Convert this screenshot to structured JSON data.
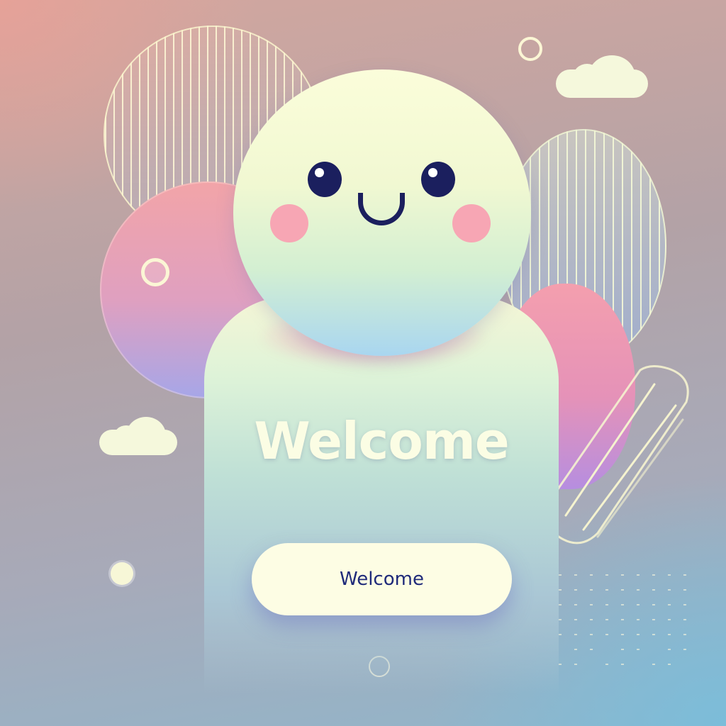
{
  "title": "Welcome",
  "button": {
    "label": "Welcome"
  },
  "colors": {
    "background_top": "#d3a79f",
    "background_bottom": "#90b6cb",
    "head": "#fbfdda",
    "eyes": "#1b1f5e",
    "cheeks": "#f7a6b4",
    "pink_circle": "#f2a4a8",
    "button_bg": "#fdfde4",
    "button_text": "#1f2a7a",
    "title_text": "#fbfde4"
  },
  "icons": [
    "smiley-character",
    "cloud-icon",
    "ring-icon",
    "dot-grid"
  ]
}
